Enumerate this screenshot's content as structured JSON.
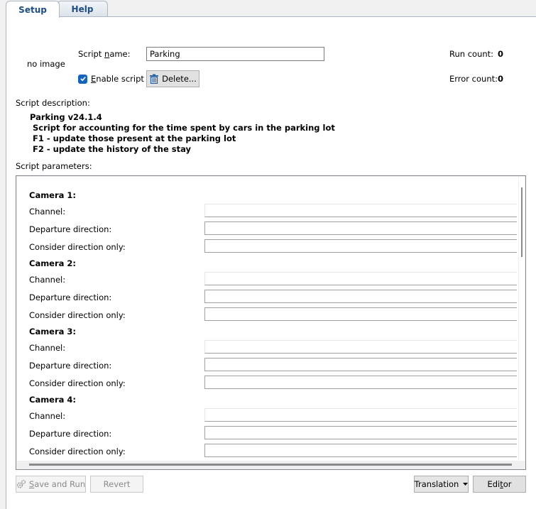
{
  "tabs": [
    {
      "label": "Setup",
      "active": true
    },
    {
      "label": "Help",
      "active": false
    }
  ],
  "header": {
    "no_image": "no image",
    "script_name_label_pre": "Script ",
    "script_name_label_u": "n",
    "script_name_label_post": "ame:",
    "script_name_value": "Parking",
    "enable_script_u": "E",
    "enable_script_post": "nable script",
    "enable_script_checked": true,
    "delete_button": "Delete...",
    "run_count_label": "Run count:",
    "run_count_value": "0",
    "error_count_label": "Error count:",
    "error_count_value": "0"
  },
  "description": {
    "heading": "Script description:",
    "lines": [
      "Parking v24.1.4",
      " Script for accounting for the time spent by cars in the parking lot",
      " F1 - update those present at the parking lot",
      " F2 - update the history of the stay"
    ]
  },
  "parameters": {
    "heading": "Script parameters:",
    "cameras": [
      {
        "title": "Camera 1:",
        "fields": [
          "Channel:",
          "Departure direction:",
          "Consider direction only:"
        ]
      },
      {
        "title": "Camera 2:",
        "fields": [
          "Channel:",
          "Departure direction:",
          "Consider direction only:"
        ]
      },
      {
        "title": "Camera 3:",
        "fields": [
          "Channel:",
          "Departure direction:",
          "Consider direction only:"
        ]
      },
      {
        "title": "Camera 4:",
        "fields": [
          "Channel:",
          "Departure direction:",
          "Consider direction only:"
        ]
      }
    ]
  },
  "footer": {
    "save_run_u": "S",
    "save_run_post": "ave and Run",
    "revert": "Revert",
    "translation": "Translation",
    "editor_pre": "Edi",
    "editor_u": "t",
    "editor_post": "or"
  },
  "colors": {
    "tab_text": "#1b4e85",
    "checkbox": "#1565c0",
    "delete_icon": "#1f5fa8"
  }
}
